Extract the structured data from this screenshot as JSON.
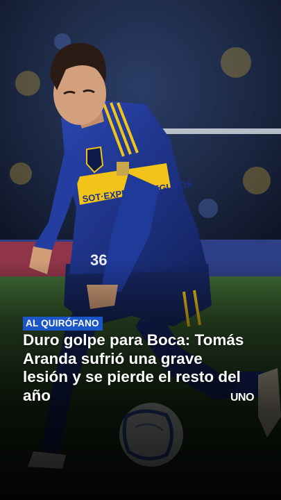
{
  "category_tag": "AL QUIRÓFANO",
  "headline": "Duro golpe para Boca: Tomás Aranda sufrió una grave lesión y se pierde el resto del año",
  "brand_logo": "UNO",
  "photo": {
    "jersey_sponsor": "EXPERTA SEGUROS",
    "jersey_number": "36"
  },
  "colors": {
    "tag_background": "#1b56c9",
    "jersey_blue": "#1a2f8a",
    "jersey_gold": "#f2c318",
    "text": "#ffffff"
  }
}
